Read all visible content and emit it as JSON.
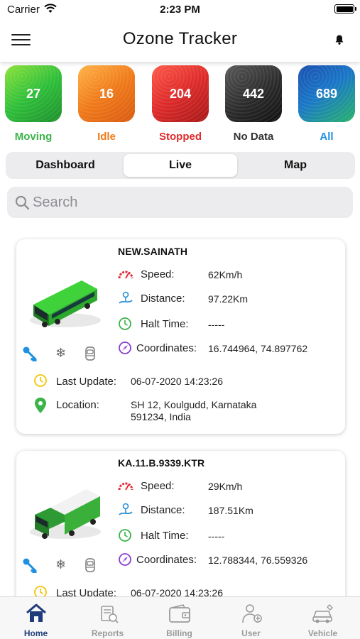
{
  "status_bar": {
    "carrier": "Carrier",
    "time": "2:23 PM"
  },
  "header": {
    "title": "Ozone Tracker"
  },
  "tiles": [
    {
      "count": "27",
      "label": "Moving",
      "color": "#2fbf3a",
      "label_color": "#3cb44a"
    },
    {
      "count": "16",
      "label": "Idle",
      "color": "#f07a1a",
      "label_color": "#f07a1a"
    },
    {
      "count": "204",
      "label": "Stopped",
      "color": "#dd2a2a",
      "label_color": "#e02b2b"
    },
    {
      "count": "442",
      "label": "No Data",
      "color": "#2b2b2b",
      "label_color": "#333333"
    },
    {
      "count": "689",
      "label": "All",
      "color": "#1976c8",
      "label_color": "#1e90e0"
    }
  ],
  "segments": {
    "items": [
      "Dashboard",
      "Live",
      "Map"
    ],
    "selected": "Live"
  },
  "search": {
    "placeholder": "Search",
    "value": ""
  },
  "labels": {
    "speed": "Speed:",
    "distance": "Distance:",
    "halt_time": "Halt Time:",
    "coordinates": "Coordinates:",
    "last_update": "Last Update:",
    "location": "Location:"
  },
  "vehicles": [
    {
      "name": "NEW.SAINATH",
      "type": "bus",
      "speed": "62Km/h",
      "distance": "97.22Km",
      "halt_time": "-----",
      "coordinates": "16.744964, 74.897762",
      "last_update": "06-07-2020 14:23:26",
      "location_line1": "SH 12, Koulgudd, Karnataka",
      "location_line2": "591234, India"
    },
    {
      "name": "KA.11.B.9339.KTR",
      "type": "truck",
      "speed": "29Km/h",
      "distance": "187.51Km",
      "halt_time": "-----",
      "coordinates": "12.788344, 76.559326",
      "last_update": "06-07-2020 14:23:26",
      "location_line1": "",
      "location_line2": ""
    }
  ],
  "tab_bar": {
    "items": [
      "Home",
      "Reports",
      "Billing",
      "User",
      "Vehicle"
    ],
    "active": "Home"
  },
  "icons": {
    "menu": "hamburger-menu-icon",
    "bell": "notification-bell-icon",
    "search": "search-icon",
    "key": "ignition-key-icon",
    "ac": "snowflake-ac-icon",
    "seat": "seat-icon",
    "speed": "speedometer-icon",
    "distance": "distance-icon",
    "halt": "clock-icon",
    "coordinates": "compass-icon",
    "update": "clock-icon",
    "location": "location-pin-icon"
  },
  "colors": {
    "accent": "#1f3c7a",
    "speed_icon": "#e0303a",
    "distance_icon": "#2a8fd6",
    "halt_icon": "#3cb44a",
    "coord_icon": "#8a3fd1",
    "update_icon": "#f2c400",
    "location_icon": "#3cb44a",
    "key_icon": "#1e90e0"
  }
}
